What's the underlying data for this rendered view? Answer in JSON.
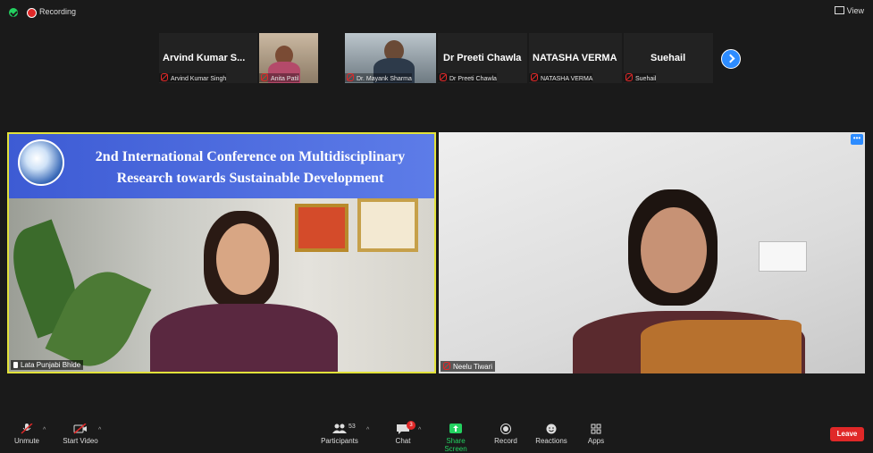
{
  "top_bar": {
    "recording_label": "Recording",
    "view_label": "View"
  },
  "strip": {
    "tiles": [
      {
        "big_name": "Arvind Kumar S...",
        "label": "Arvind Kumar Singh"
      },
      {
        "big_name": "",
        "label": "Anita Patil"
      },
      {
        "big_name": "",
        "label": "Dr. Mayank Sharma"
      },
      {
        "big_name": "Dr Preeti Chawla",
        "label": "Dr Preeti Chawla"
      },
      {
        "big_name": "NATASHA VERMA",
        "label": "NATASHA VERMA"
      },
      {
        "big_name": "Suehail",
        "label": "Suehail"
      }
    ]
  },
  "left_video": {
    "banner_line1": "2nd International Conference on Multidisciplinary",
    "banner_line2": "Research towards Sustainable Development",
    "name": "Lata Punjabi Bhide"
  },
  "right_video": {
    "name": "Neelu Tiwari",
    "more": "•••"
  },
  "toolbar": {
    "unmute": "Unmute",
    "start_video": "Start Video",
    "participants": "Participants",
    "participants_count": "53",
    "chat": "Chat",
    "chat_badge": "3",
    "share_screen": "Share Screen",
    "record": "Record",
    "reactions": "Reactions",
    "apps": "Apps",
    "leave": "Leave"
  },
  "colors": {
    "accent": "#2d8cff",
    "share": "#23d160",
    "leave": "#e02828",
    "active_speaker": "#e2e23a"
  }
}
